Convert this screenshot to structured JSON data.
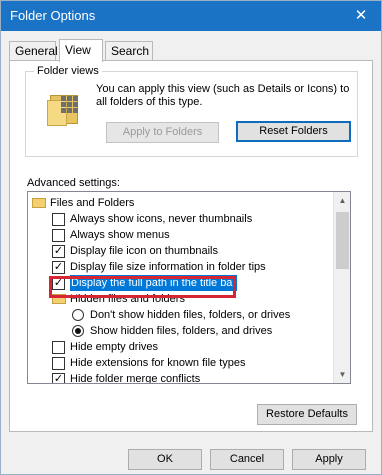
{
  "window": {
    "title": "Folder Options",
    "close_label": "✕"
  },
  "tabs": [
    {
      "label": "General"
    },
    {
      "label": "View",
      "selected": true
    },
    {
      "label": "Search"
    }
  ],
  "folder_views": {
    "legend": "Folder views",
    "description": "You can apply this view (such as Details or Icons) to all folders of this type.",
    "apply_button": "Apply to Folders",
    "reset_button": "Reset Folders"
  },
  "advanced": {
    "label": "Advanced settings:",
    "items": [
      {
        "type": "folder",
        "label": "Files and Folders"
      },
      {
        "type": "checkbox",
        "checked": false,
        "label": "Always show icons, never thumbnails"
      },
      {
        "type": "checkbox",
        "checked": false,
        "label": "Always show menus"
      },
      {
        "type": "checkbox",
        "checked": true,
        "label": "Display file icon on thumbnails"
      },
      {
        "type": "checkbox",
        "checked": true,
        "label": "Display file size information in folder tips"
      },
      {
        "type": "checkbox",
        "checked": true,
        "label": "Display the full path in the title bar",
        "selected": true
      },
      {
        "type": "folder",
        "label": "Hidden files and folders"
      },
      {
        "type": "radio",
        "checked": false,
        "label": "Don't show hidden files, folders, or drives"
      },
      {
        "type": "radio",
        "checked": true,
        "label": "Show hidden files, folders, and drives"
      },
      {
        "type": "checkbox",
        "checked": false,
        "label": "Hide empty drives"
      },
      {
        "type": "checkbox",
        "checked": false,
        "label": "Hide extensions for known file types"
      },
      {
        "type": "checkbox",
        "checked": true,
        "label": "Hide folder merge conflicts"
      }
    ]
  },
  "restore_button": "Restore Defaults",
  "footer": {
    "ok": "OK",
    "cancel": "Cancel",
    "apply": "Apply"
  },
  "colors": {
    "titlebar": "#1b73c5",
    "selection": "#0078d7",
    "highlight_box": "#d72633"
  },
  "icons": {
    "close": "close-icon",
    "folder_view": "folder-view-icon",
    "tree_folder": "folder-icon",
    "scroll_up": "chevron-up-icon",
    "scroll_down": "chevron-down-icon"
  }
}
